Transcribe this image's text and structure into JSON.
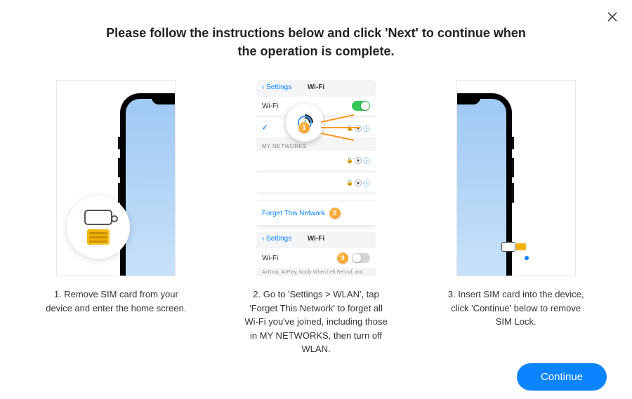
{
  "dialog": {
    "heading": "Please follow the instructions below and click 'Next' to continue when the operation is complete."
  },
  "steps": [
    {
      "caption": "1. Remove SIM card from your device and enter the home screen."
    },
    {
      "caption": "2. Go to 'Settings > WLAN', tap 'Forget This Network' to forget all Wi-Fi you've joined, including those in MY NETWORKS, then turn off WLAN."
    },
    {
      "caption": "3. Insert SIM card  into the device, click 'Continue' below to remove SIM Lock."
    }
  ],
  "wifi_panel": {
    "back_label": "Settings",
    "title": "Wi-Fi",
    "wifi_row_label": "Wi-Fi",
    "section_my_networks": "MY NETWORKS",
    "forget_label": "Forget This Network",
    "wifi_off_subnote": "AirDrop, AirPlay, Notify When Left Behind, and improved location accuracy require Wi-Fi.",
    "badge_1": "1",
    "badge_2": "2",
    "badge_3": "3"
  },
  "buttons": {
    "continue": "Continue"
  }
}
